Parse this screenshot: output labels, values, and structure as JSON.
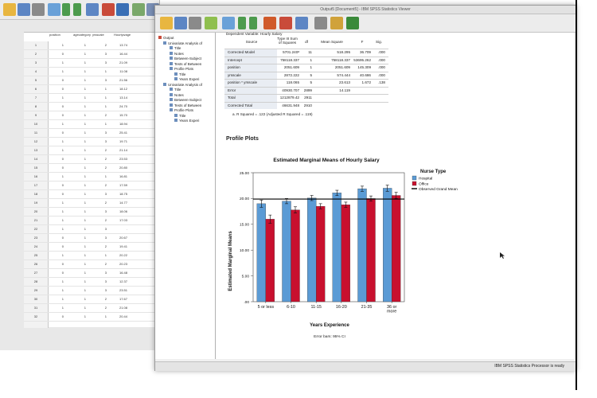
{
  "editor": {
    "columns": [
      "position",
      "agecategory",
      "yrsscale",
      "Hourlywage"
    ],
    "rows": [
      {
        "n": "1",
        "c": [
          "1",
          "1",
          "2",
          "13.74"
        ]
      },
      {
        "n": "2",
        "c": [
          "0",
          "1",
          "3",
          "16.44"
        ]
      },
      {
        "n": "3",
        "c": [
          "1",
          "1",
          "3",
          "21.09"
        ]
      },
      {
        "n": "4",
        "c": [
          "1",
          "1",
          "1",
          "11.08"
        ]
      },
      {
        "n": "5",
        "c": [
          "0",
          "1",
          "3",
          "21.56"
        ]
      },
      {
        "n": "6",
        "c": [
          "0",
          "1",
          "1",
          "18.12"
        ]
      },
      {
        "n": "7",
        "c": [
          "1",
          "1",
          "1",
          "13.14"
        ]
      },
      {
        "n": "8",
        "c": [
          "0",
          "1",
          "1",
          "24.70"
        ]
      },
      {
        "n": "9",
        "c": [
          "0",
          "1",
          "2",
          "15.70"
        ]
      },
      {
        "n": "10",
        "c": [
          "1",
          "1",
          "1",
          "18.94"
        ]
      },
      {
        "n": "11",
        "c": [
          "0",
          "1",
          "3",
          "25.41"
        ]
      },
      {
        "n": "12",
        "c": [
          "1",
          "1",
          "3",
          "19.71"
        ]
      },
      {
        "n": "13",
        "c": [
          "1",
          "1",
          "2",
          "21.14"
        ]
      },
      {
        "n": "14",
        "c": [
          "0",
          "1",
          "2",
          "23.53"
        ]
      },
      {
        "n": "15",
        "c": [
          "0",
          "1",
          "2",
          "20.80"
        ]
      },
      {
        "n": "16",
        "c": [
          "1",
          "1",
          "1",
          "16.81"
        ]
      },
      {
        "n": "17",
        "c": [
          "0",
          "1",
          "2",
          "17.59"
        ]
      },
      {
        "n": "18",
        "c": [
          "0",
          "1",
          "3",
          "18.75"
        ]
      },
      {
        "n": "19",
        "c": [
          "1",
          "1",
          "2",
          "14.77"
        ]
      },
      {
        "n": "20",
        "c": [
          "1",
          "1",
          "3",
          "18.06"
        ]
      },
      {
        "n": "21",
        "c": [
          "1",
          "1",
          "2",
          "17.03"
        ]
      },
      {
        "n": "22",
        "c": [
          "1",
          "1",
          "3",
          "."
        ]
      },
      {
        "n": "23",
        "c": [
          "0",
          "1",
          "3",
          "20.67"
        ]
      },
      {
        "n": "24",
        "c": [
          "0",
          "1",
          "2",
          "19.41"
        ]
      },
      {
        "n": "25",
        "c": [
          "1",
          "1",
          "1",
          "20.22"
        ]
      },
      {
        "n": "26",
        "c": [
          "0",
          "1",
          "2",
          "20.23"
        ]
      },
      {
        "n": "27",
        "c": [
          "0",
          "1",
          "3",
          "16.48"
        ]
      },
      {
        "n": "28",
        "c": [
          "1",
          "1",
          "3",
          "12.37"
        ]
      },
      {
        "n": "29",
        "c": [
          "1",
          "1",
          "3",
          "23.51"
        ]
      },
      {
        "n": "30",
        "c": [
          "1",
          "1",
          "2",
          "17.67"
        ]
      },
      {
        "n": "31",
        "c": [
          "1",
          "1",
          "2",
          "21.08"
        ]
      },
      {
        "n": "32",
        "c": [
          "0",
          "1",
          "1",
          "20.44"
        ]
      }
    ]
  },
  "viewer": {
    "title": "Output5 [Document5] - IBM SPSS Statistics Viewer",
    "status": "IBM SPSS Statistics Processor is ready",
    "outline": [
      "Output",
      "Univariate Analysis of",
      "Title",
      "Notes",
      "Between-Subject",
      "Tests of Between",
      "Profile Plots",
      "Title",
      "Years Experi",
      "Univariate Analysis of",
      "Title",
      "Notes",
      "Between-Subject",
      "Tests of Between",
      "Profile Plots",
      "Title",
      "Years Experi"
    ]
  },
  "anova": {
    "dependent": "Dependent Variable:   Hourly Salary",
    "headers": [
      "Source",
      "Type III Sum of Squares",
      "df",
      "Mean Square",
      "F",
      "Sig."
    ],
    "rows": [
      [
        "Corrected Model",
        "5701.240ᵃ",
        "11",
        "518.295",
        "36.709",
        ".000"
      ],
      [
        "Intercept",
        "758118.337",
        "1",
        "758118.337",
        "53695.262",
        ".000"
      ],
      [
        "position",
        "2051.609",
        "1",
        "2051.609",
        "145.309",
        ".000"
      ],
      [
        "yrsscale",
        "2872.222",
        "5",
        "574.444",
        "40.686",
        ".000"
      ],
      [
        "position * yrsscale",
        "118.065",
        "5",
        "23.613",
        "1.672",
        ".138"
      ],
      [
        "Error",
        "40930.707",
        "2899",
        "14.119",
        "",
        ""
      ],
      [
        "Total",
        "1212879.42",
        "2911",
        "",
        "",
        ""
      ],
      [
        "Corrected Total",
        "46631.948",
        "2910",
        "",
        "",
        ""
      ]
    ],
    "footnote": "a. R Squared = .122 (Adjusted R Squared = .119)"
  },
  "profile_heading": "Profile Plots",
  "chart_data": {
    "type": "bar",
    "title": "Estimated Marginal Means of Hourly Salary",
    "xlabel": "Years Experience",
    "ylabel": "Estimated Marginal Means",
    "categories": [
      "5 or less",
      "6-10",
      "11-15",
      "16-20",
      "21-35",
      "36 or more"
    ],
    "series": [
      {
        "name": "Hospital",
        "color": "#5b9bd5",
        "values": [
          19.0,
          19.5,
          20.1,
          21.1,
          21.9,
          22.0
        ]
      },
      {
        "name": "Office",
        "color": "#c8102e",
        "values": [
          16.0,
          17.8,
          18.5,
          18.8,
          20.0,
          20.6
        ]
      }
    ],
    "errors": [
      {
        "series": 0,
        "values": [
          0.7,
          0.5,
          0.5,
          0.5,
          0.5,
          0.6
        ]
      },
      {
        "series": 1,
        "values": [
          0.8,
          0.6,
          0.5,
          0.5,
          0.5,
          0.6
        ]
      }
    ],
    "reference_line": {
      "name": "Observed Grand Mean",
      "value": 19.9
    },
    "legend_title": "Nurse Type",
    "ylim": [
      0,
      25
    ],
    "yticks": [
      "25.00",
      "20.00",
      "15.00",
      "10.00",
      "5.00",
      ".00"
    ],
    "footnote": "Error bars: 95% CI"
  }
}
